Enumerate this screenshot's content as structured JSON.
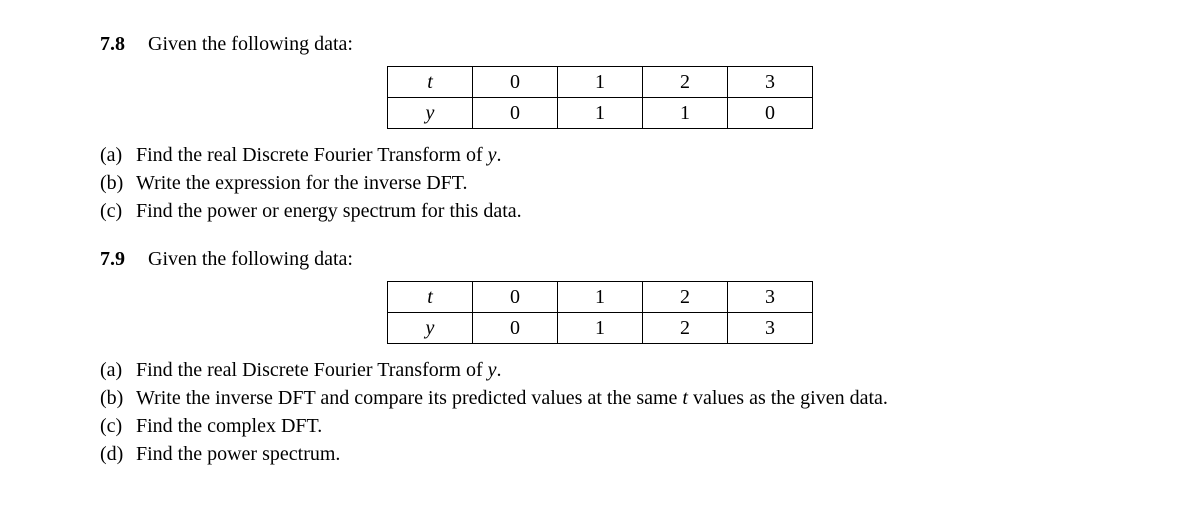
{
  "problems": [
    {
      "number": "7.8",
      "title": "Given the following data:",
      "table": {
        "rows": [
          {
            "header": "t",
            "values": [
              "0",
              "1",
              "2",
              "3"
            ]
          },
          {
            "header": "y",
            "values": [
              "0",
              "1",
              "1",
              "0"
            ]
          }
        ]
      },
      "parts": [
        {
          "label": "(a)",
          "text_pre": "Find the real Discrete Fourier Transform of ",
          "var": "y",
          "text_post": "."
        },
        {
          "label": "(b)",
          "text_pre": "Write the expression for the inverse DFT.",
          "var": "",
          "text_post": ""
        },
        {
          "label": "(c)",
          "text_pre": "Find the power or energy spectrum for this data.",
          "var": "",
          "text_post": ""
        }
      ]
    },
    {
      "number": "7.9",
      "title": "Given the following data:",
      "table": {
        "rows": [
          {
            "header": "t",
            "values": [
              "0",
              "1",
              "2",
              "3"
            ]
          },
          {
            "header": "y",
            "values": [
              "0",
              "1",
              "2",
              "3"
            ]
          }
        ]
      },
      "parts": [
        {
          "label": "(a)",
          "text_pre": "Find the real Discrete Fourier Transform of ",
          "var": "y",
          "text_post": "."
        },
        {
          "label": "(b)",
          "text_pre": "Write the inverse DFT and compare its predicted values at the same ",
          "var": "t",
          "text_post": " values as the given data."
        },
        {
          "label": "(c)",
          "text_pre": "Find the complex DFT.",
          "var": "",
          "text_post": ""
        },
        {
          "label": "(d)",
          "text_pre": "Find the power spectrum.",
          "var": "",
          "text_post": ""
        }
      ]
    }
  ]
}
